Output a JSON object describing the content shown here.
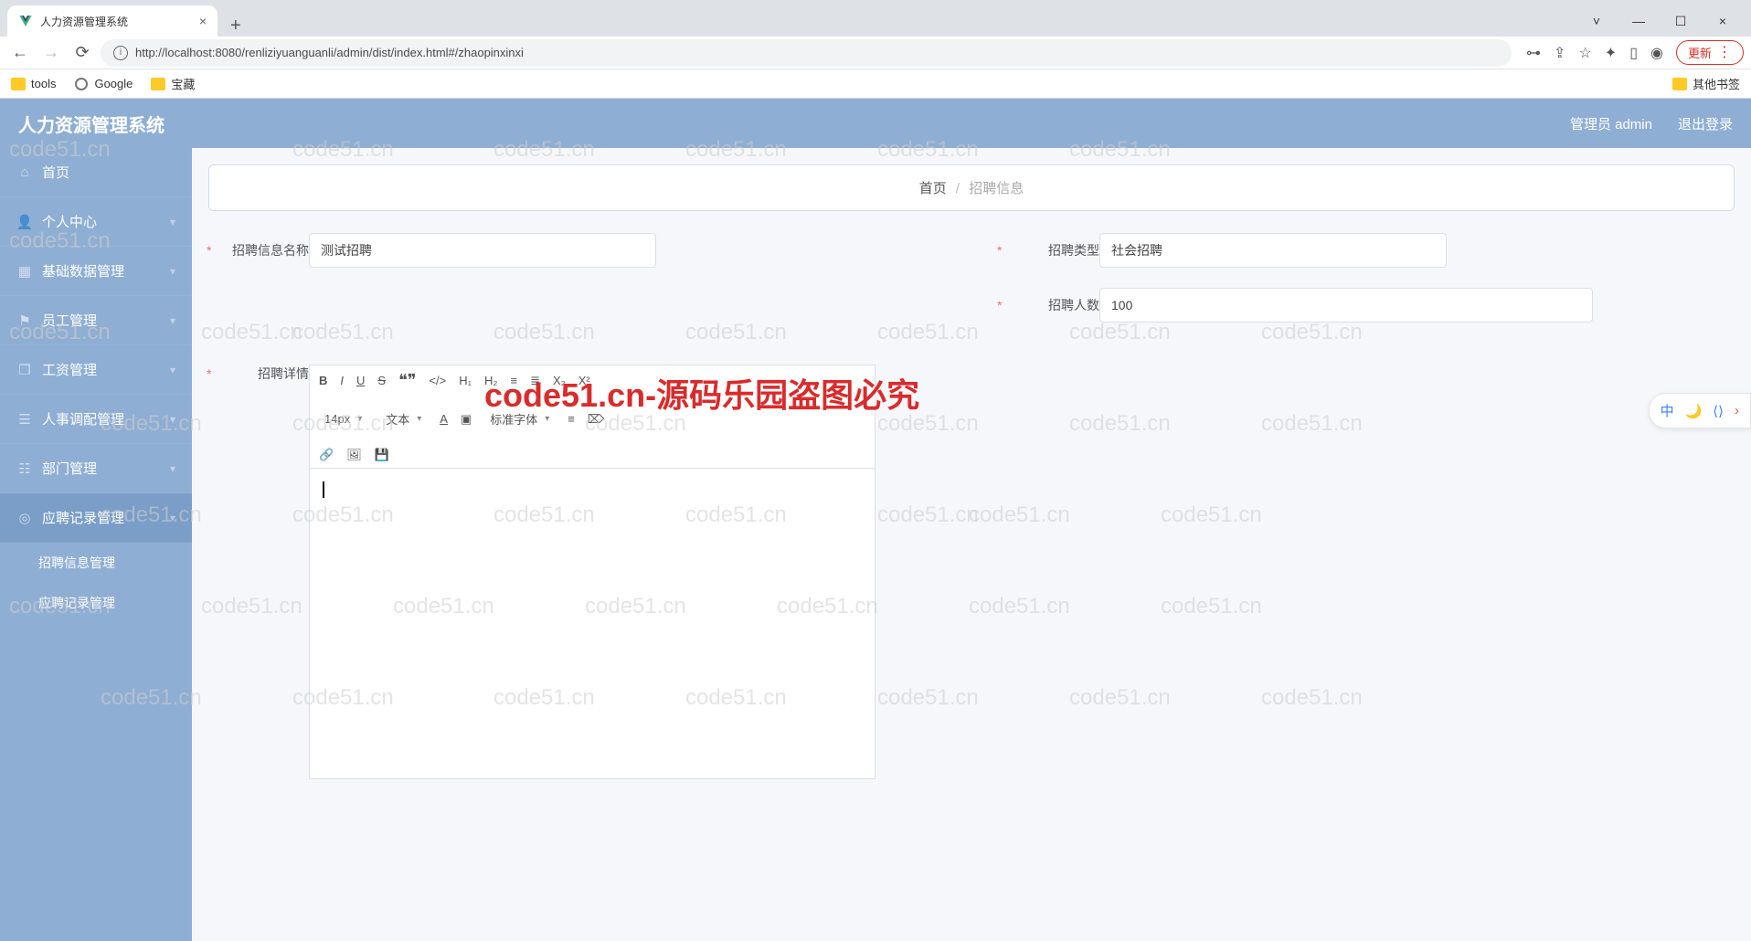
{
  "browser": {
    "tab_title": "人力资源管理系统",
    "url": "http://localhost:8080/renliziyuanguanli/admin/dist/index.html#/zhaopinxinxi",
    "bookmarks": {
      "tools": "tools",
      "google": "Google",
      "baozang": "宝藏",
      "other": "其他书签"
    },
    "update_label": "更新"
  },
  "header": {
    "title": "人力资源管理系统",
    "user_label": "管理员 admin",
    "logout_label": "退出登录"
  },
  "sidebar": {
    "items": [
      {
        "label": "首页"
      },
      {
        "label": "个人中心"
      },
      {
        "label": "基础数据管理"
      },
      {
        "label": "员工管理"
      },
      {
        "label": "工资管理"
      },
      {
        "label": "人事调配管理"
      },
      {
        "label": "部门管理"
      },
      {
        "label": "应聘记录管理"
      }
    ],
    "sub_items": [
      {
        "label": "招聘信息管理"
      },
      {
        "label": "应聘记录管理"
      }
    ]
  },
  "breadcrumb": {
    "home": "首页",
    "current": "招聘信息"
  },
  "form": {
    "name_label": "招聘信息名称",
    "name_value": "测试招聘",
    "type_label": "招聘类型",
    "type_value": "社会招聘",
    "count_label": "招聘人数",
    "count_value": "100",
    "detail_label": "招聘详情"
  },
  "editor": {
    "font_size": "14px",
    "block_type": "文本",
    "font_family": "标准字体"
  },
  "watermark": {
    "small": "code51.cn",
    "big": "code51.cn-源码乐园盗图必究"
  },
  "float": {
    "lang": "中"
  }
}
